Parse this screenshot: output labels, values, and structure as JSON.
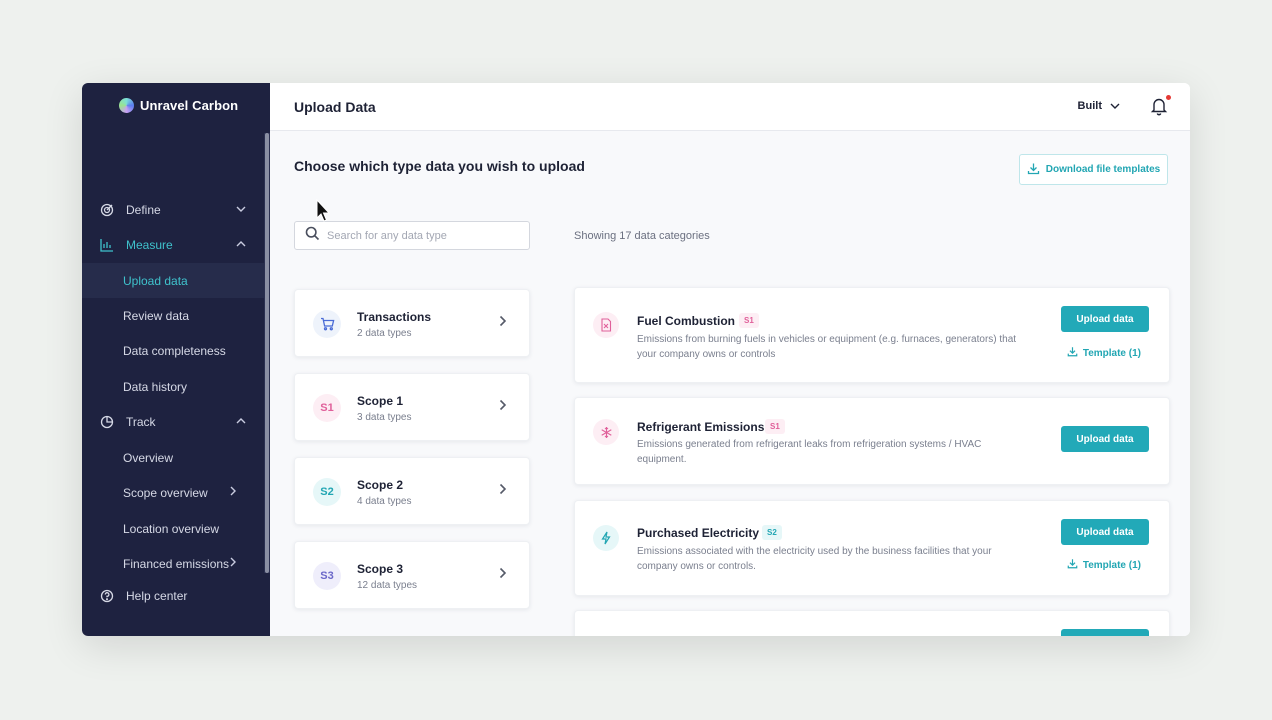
{
  "app": {
    "name": "Unravel Carbon"
  },
  "header": {
    "title": "Upload Data",
    "org": "Built"
  },
  "sidebar": {
    "groups": [
      {
        "label": "Define",
        "icon": "target-icon"
      },
      {
        "label": "Measure",
        "icon": "bar-chart-icon"
      },
      {
        "label": "Track",
        "icon": "pie-chart-icon"
      }
    ],
    "measure_items": [
      "Upload data",
      "Review data",
      "Data completeness",
      "Data history"
    ],
    "track_items": [
      "Overview",
      "Scope overview",
      "Location overview",
      "Financed emissions"
    ],
    "help": "Help center"
  },
  "main": {
    "heading": "Choose which type data you wish to upload",
    "download_templates": "Download file templates",
    "search_placeholder": "Search for any data type",
    "showing": "Showing 17 data categories"
  },
  "categories": [
    {
      "name": "Transactions",
      "count": "2 data types",
      "badge": "",
      "icon": "cart-icon",
      "color": "#4a6bd6",
      "bg": "#eef3fb"
    },
    {
      "name": "Scope 1",
      "count": "3 data types",
      "badge": "S1",
      "color": "#e0609a",
      "bg": "#fdeef4"
    },
    {
      "name": "Scope 2",
      "count": "4 data types",
      "badge": "S2",
      "color": "#22a6b3",
      "bg": "#e6f7f8"
    },
    {
      "name": "Scope 3",
      "count": "12 data types",
      "badge": "S3",
      "color": "#6b68c9",
      "bg": "#efeefb"
    }
  ],
  "datasets": [
    {
      "name": "Fuel Combustion",
      "badge": "S1",
      "desc": "Emissions from burning fuels in vehicles or equipment (e.g. furnaces, generators) that your company owns or controls",
      "upload": "Upload data",
      "template": "Template (1)",
      "icon": "fuel-icon"
    },
    {
      "name": "Refrigerant Emissions",
      "badge": "S1",
      "desc": "Emissions generated from refrigerant leaks from refrigeration systems / HVAC equipment.",
      "upload": "Upload data",
      "template": "",
      "icon": "snowflake-icon"
    },
    {
      "name": "Purchased Electricity",
      "badge": "S2",
      "desc": "Emissions associated with the electricity used by the business facilities that your company owns or controls.",
      "upload": "Upload data",
      "template": "Template (1)",
      "icon": "lightning-icon"
    }
  ],
  "colors": {
    "accent": "#22a9b8",
    "sidebar": "#1e2240",
    "s1": "#e0609a",
    "s2": "#22a6b3",
    "s3": "#6b68c9"
  }
}
